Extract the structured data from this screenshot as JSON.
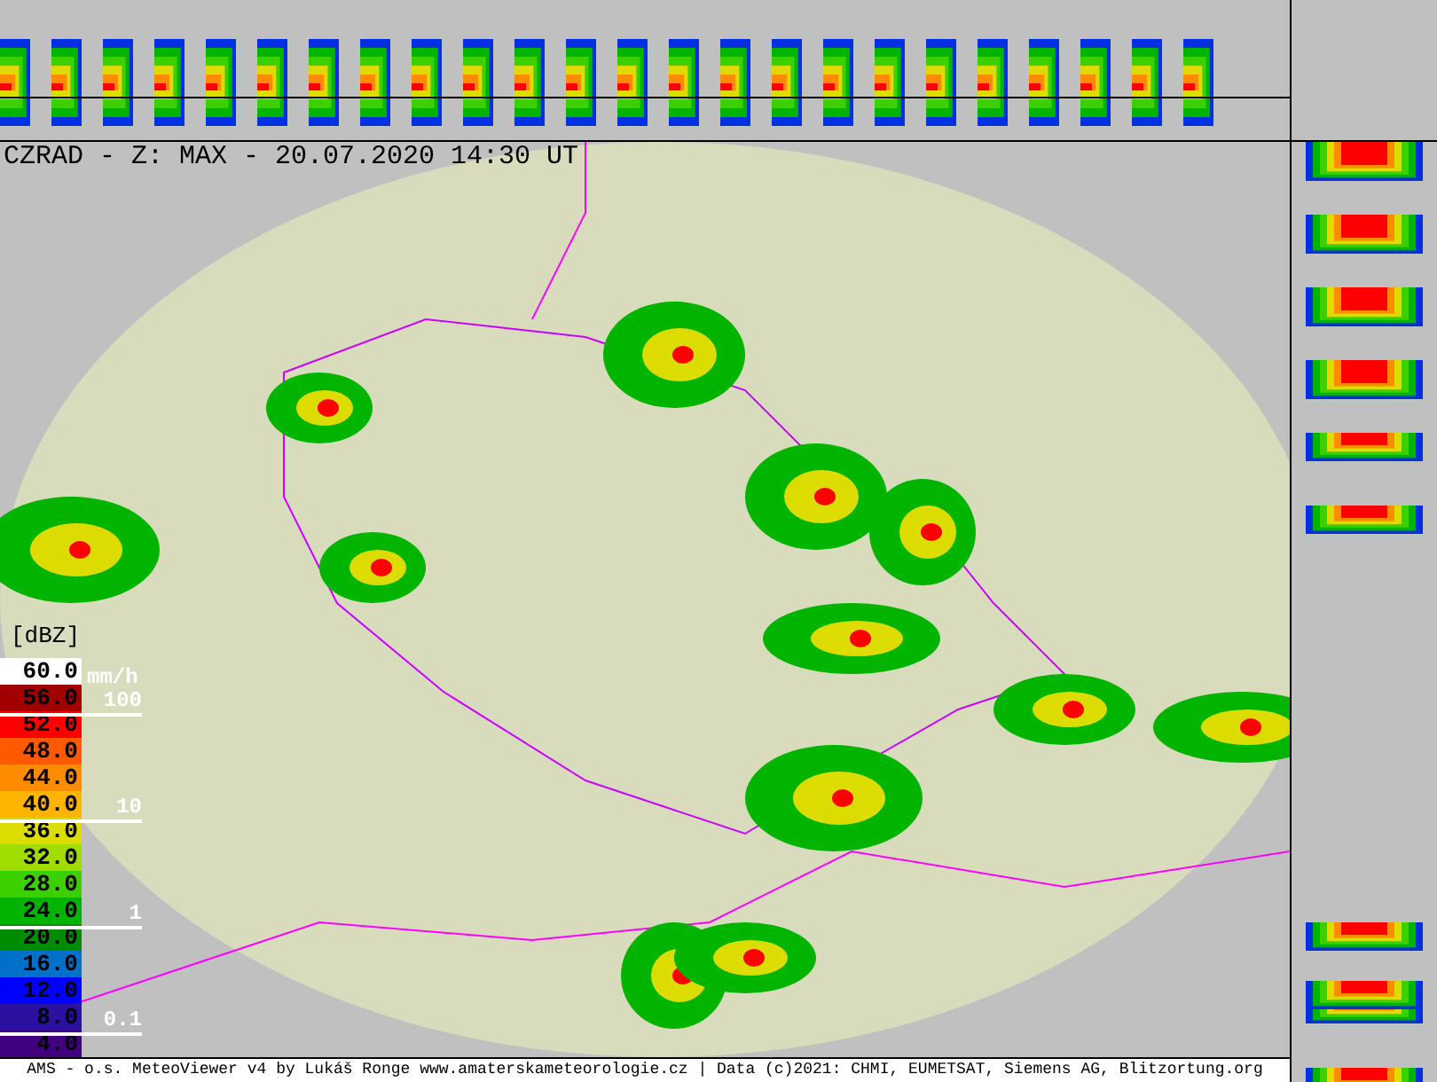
{
  "title": "CZRAD - Z: MAX - 20.07.2020 14:30 UT",
  "legend": {
    "unit": "[dBZ]",
    "rate_unit": "mm/h",
    "entries": [
      {
        "value": "60.0",
        "color": "#ffffff"
      },
      {
        "value": "56.0",
        "color": "#a00000",
        "rate": "100"
      },
      {
        "value": "52.0",
        "color": "#ff0000"
      },
      {
        "value": "48.0",
        "color": "#ff5a00"
      },
      {
        "value": "44.0",
        "color": "#ff8c00"
      },
      {
        "value": "40.0",
        "color": "#ffb400",
        "rate": "10"
      },
      {
        "value": "36.0",
        "color": "#dcdc00"
      },
      {
        "value": "32.0",
        "color": "#a0dc00"
      },
      {
        "value": "28.0",
        "color": "#3cd000"
      },
      {
        "value": "24.0",
        "color": "#00b400",
        "rate": "1"
      },
      {
        "value": "20.0",
        "color": "#008c00"
      },
      {
        "value": "16.0",
        "color": "#0070c8"
      },
      {
        "value": "12.0",
        "color": "#0000ff"
      },
      {
        "value": "8.0",
        "color": "#2c10a0",
        "rate": "0.1"
      },
      {
        "value": "4.0",
        "color": "#400080"
      }
    ]
  },
  "credits": "AMS - o.s. MeteoViewer v4 by Lukáš Ronge www.amaterskameteorologie.cz | Data (c)2021: CHMI, EUMETSAT, Siemens AG, Blitzortung.org"
}
